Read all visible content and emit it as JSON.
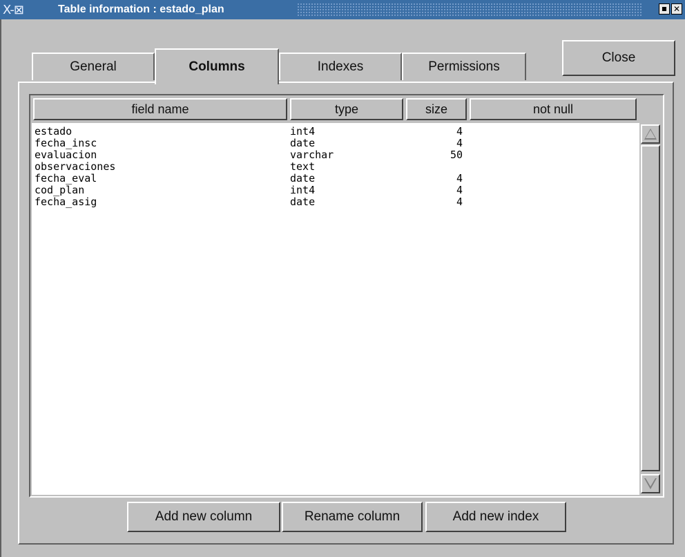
{
  "window": {
    "title": "Table information : estado_plan",
    "icon_text": "X-⊠",
    "colors": {
      "titlebar": "#3a6ea5",
      "background": "#c0c0c0",
      "list_background": "#ffffff"
    }
  },
  "tabs": [
    {
      "label": "General",
      "active": false
    },
    {
      "label": "Columns",
      "active": true
    },
    {
      "label": "Indexes",
      "active": false
    },
    {
      "label": "Permissions",
      "active": false
    }
  ],
  "close_label": "Close",
  "columns_table": {
    "headers": {
      "field_name": "field name",
      "type": "type",
      "size": "size",
      "not_null": "not null"
    },
    "rows": [
      {
        "name": "estado",
        "type": "int4",
        "size": "4",
        "not_null": ""
      },
      {
        "name": "fecha_insc",
        "type": "date",
        "size": "4",
        "not_null": ""
      },
      {
        "name": "evaluacion",
        "type": "varchar",
        "size": "50",
        "not_null": ""
      },
      {
        "name": "observaciones",
        "type": "text",
        "size": "",
        "not_null": ""
      },
      {
        "name": "fecha_eval",
        "type": "date",
        "size": "4",
        "not_null": ""
      },
      {
        "name": "cod_plan",
        "type": "int4",
        "size": "4",
        "not_null": ""
      },
      {
        "name": "fecha_asig",
        "type": "date",
        "size": "4",
        "not_null": ""
      }
    ]
  },
  "buttons": {
    "add_column": "Add new column",
    "rename_column": "Rename column",
    "add_index": "Add new index"
  }
}
